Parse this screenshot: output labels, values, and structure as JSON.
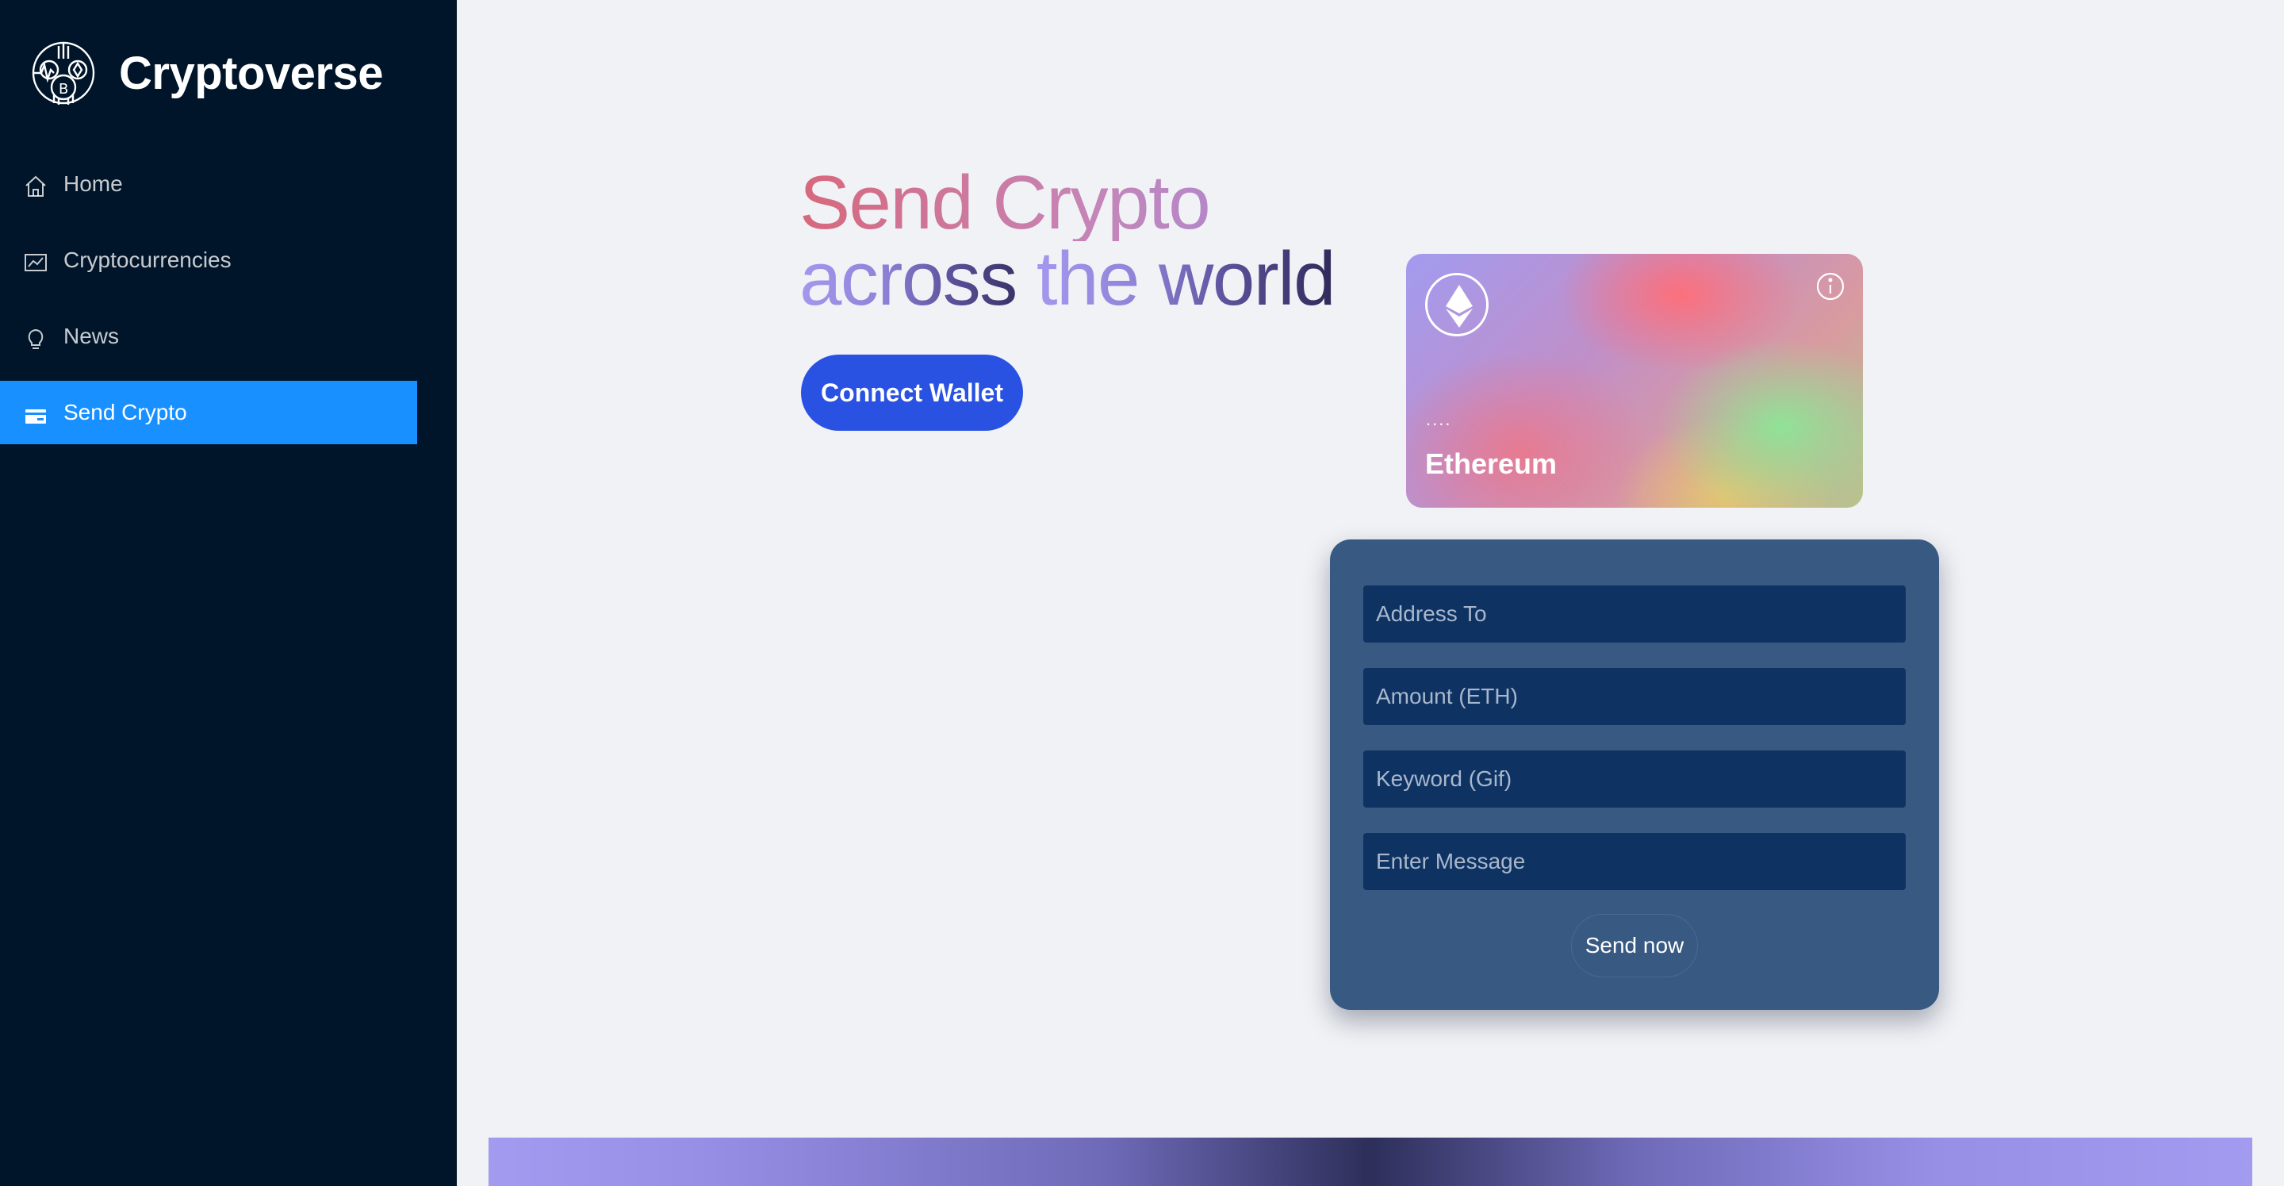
{
  "sidebar": {
    "brand_name": "Cryptoverse",
    "items": [
      {
        "label": "Home",
        "icon": "home-icon"
      },
      {
        "label": "Cryptocurrencies",
        "icon": "line-chart-icon"
      },
      {
        "label": "News",
        "icon": "bulb-icon"
      },
      {
        "label": "Send Crypto",
        "icon": "credit-card-icon",
        "active": true
      }
    ]
  },
  "hero": {
    "line1": "Send Crypto",
    "line2_part1": "across ",
    "line2_part2": "the world",
    "connect_label": "Connect Wallet"
  },
  "card": {
    "address": "....",
    "network": "Ethereum",
    "logo_icon": "ethereum-icon",
    "info_icon": "info-icon"
  },
  "form": {
    "address_placeholder": "Address To",
    "amount_placeholder": "Amount (ETH)",
    "keyword_placeholder": "Keyword (Gif)",
    "message_placeholder": "Enter Message",
    "send_label": "Send now"
  },
  "colors": {
    "sidebar_bg": "#001529",
    "active_item": "#1890ff",
    "connect_button": "#2952e3",
    "form_bg": "#385982",
    "input_bg": "#0e3363"
  }
}
